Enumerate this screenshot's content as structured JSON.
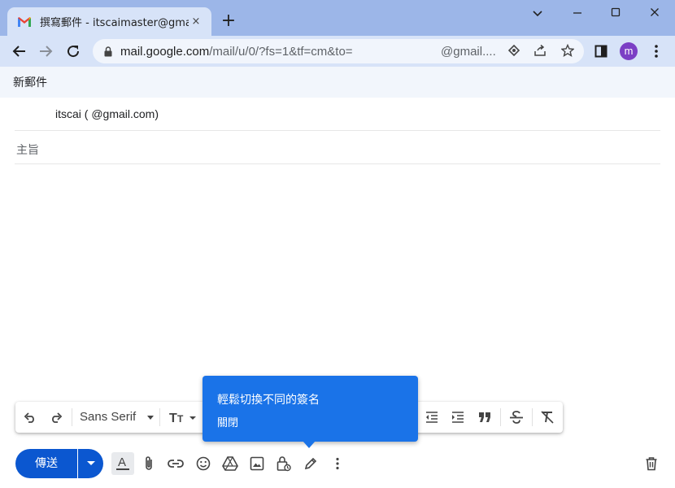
{
  "browser": {
    "tab_title": "撰寫郵件 - itscaimaster@gmail.com",
    "tab_close": "×",
    "new_tab": "+",
    "url_host": "mail.google.com",
    "url_path": "/mail/u/0/?fs=1&tf=cm&to=",
    "url_tail": "@gmail....",
    "profile_initial": "m"
  },
  "compose": {
    "header_title": "新郵件",
    "to_value": "itscai (                    @gmail.com)",
    "subject_label": "主旨"
  },
  "format_bar": {
    "font_name": "Sans Serif"
  },
  "tooltip": {
    "title": "輕鬆切換不同的簽名",
    "dismiss": "關閉"
  },
  "actions": {
    "send_label": "傳送"
  },
  "colors": {
    "accent": "#1a73e8",
    "send_button": "#0b57d0",
    "tabstrip": "#9cb6e8",
    "toolbar": "#d7e3f8"
  }
}
